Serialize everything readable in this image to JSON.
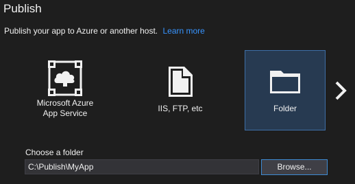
{
  "header": {
    "title": "Publish",
    "subtitle": "Publish your app to Azure or another host.",
    "learn_more": "Learn more"
  },
  "targets": [
    {
      "label": "Microsoft Azure\nApp Service",
      "icon": "azure-cloud-icon",
      "selected": false
    },
    {
      "label": "IIS, FTP, etc",
      "icon": "document-icon",
      "selected": false
    },
    {
      "label": "Folder",
      "icon": "folder-icon",
      "selected": true
    }
  ],
  "folder": {
    "label": "Choose a folder",
    "value": "C:\\Publish\\MyApp",
    "browse_label": "Browse..."
  },
  "colors": {
    "background": "#1e1e1e",
    "selected_tile": "#273a51",
    "selected_border": "#3e6fa7",
    "link": "#3794ff",
    "button_border": "#3e8bd4"
  }
}
